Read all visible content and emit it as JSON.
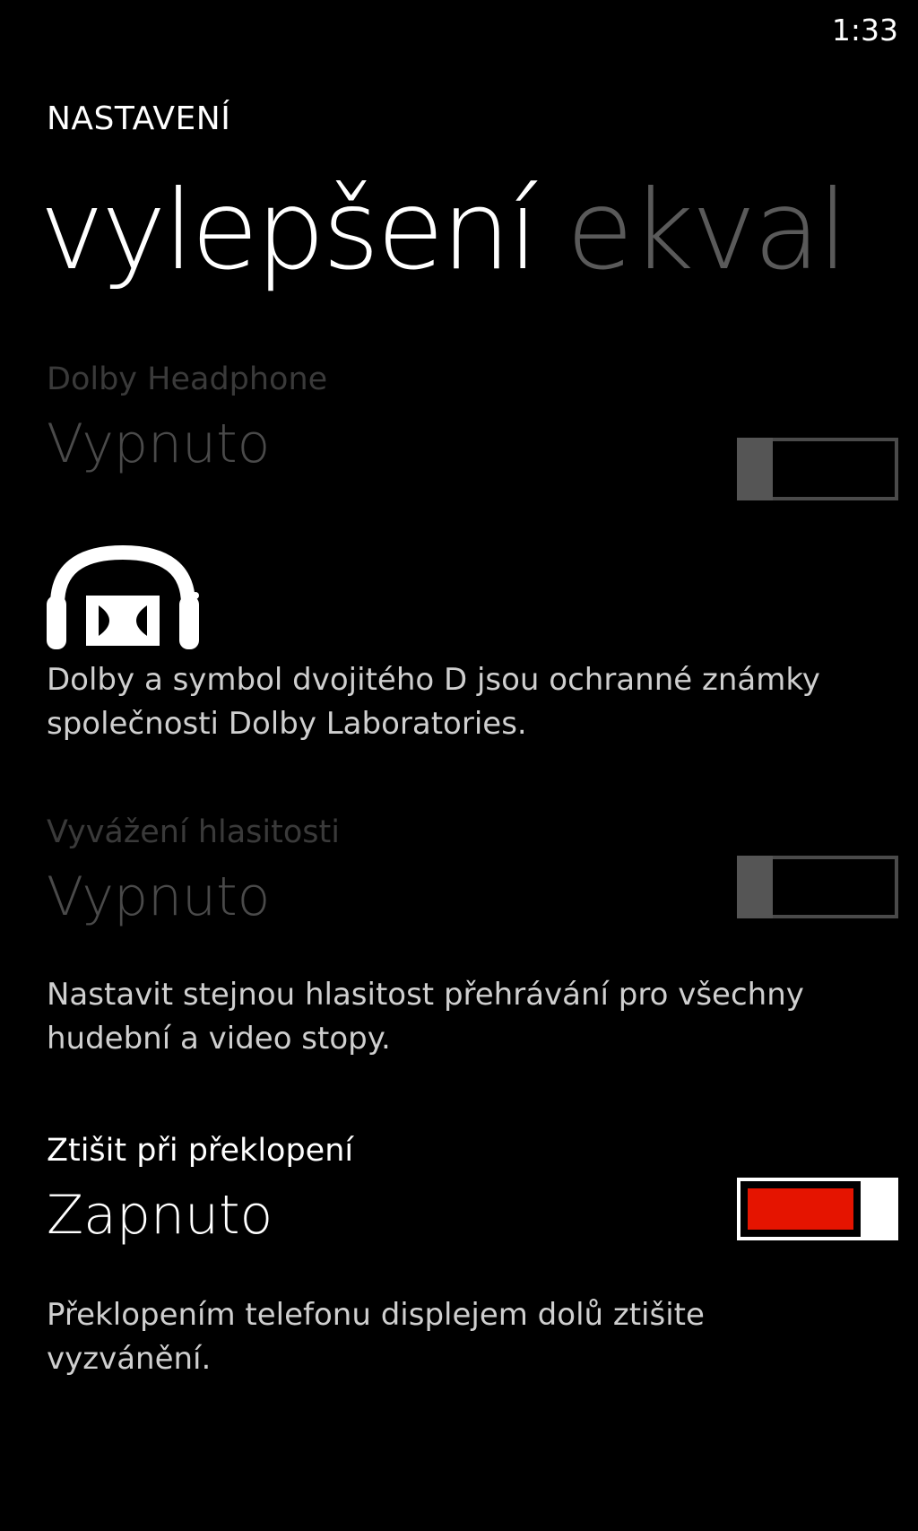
{
  "status_bar": {
    "time": "1:33"
  },
  "header": {
    "app_title": "NASTAVENÍ"
  },
  "pivot": {
    "items": [
      {
        "label": "vylepšení",
        "active": true
      },
      {
        "label": "ekval",
        "active": false
      }
    ]
  },
  "settings": [
    {
      "label": "Dolby Headphone",
      "value": "Vypnuto",
      "enabled": false,
      "toggle_on": false
    },
    {
      "description": "Dolby a symbol dvojitého D jsou ochranné známky společnosti Dolby Laboratories.",
      "icon": "dolby-headphone-logo-icon"
    },
    {
      "label": "Vyvážení hlasitosti",
      "value": "Vypnuto",
      "enabled": false,
      "toggle_on": false,
      "description": "Nastavit stejnou hlasitost přehrávání pro všechny hudební a video stopy."
    },
    {
      "label": "Ztišit při překlopení",
      "value": "Zapnuto",
      "enabled": true,
      "toggle_on": true,
      "description": "Překlopením telefonu displejem dolů ztišite vyzvánění."
    }
  ],
  "colors": {
    "background": "#000000",
    "accent": "#e51400",
    "disabled_text": "#4a4a4a",
    "inactive_pivot": "#5a5a5a"
  }
}
